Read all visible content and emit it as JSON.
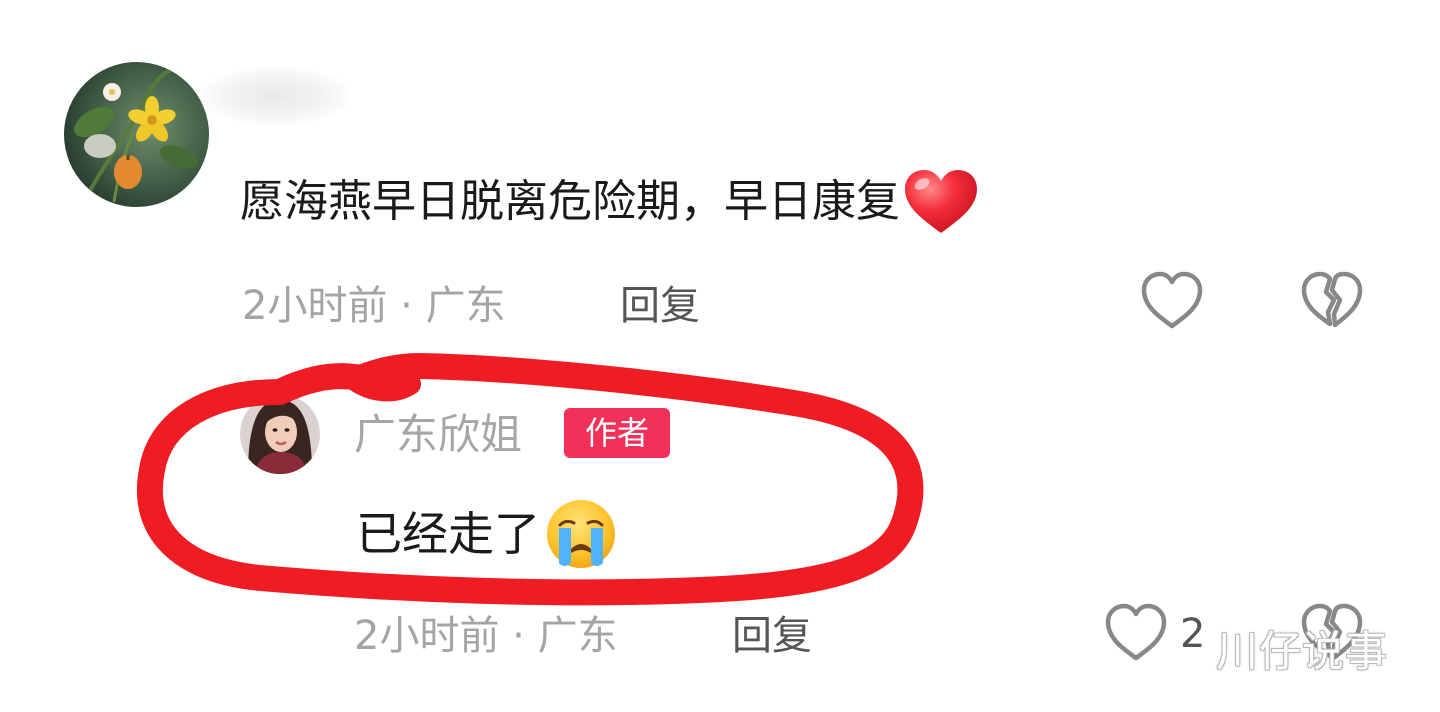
{
  "comment": {
    "text": "愿海燕早日脱离危险期，早日康复",
    "emoji": "red-heart-emoji",
    "meta": "2小时前 · 广东",
    "reply_label": "回复"
  },
  "reply": {
    "username": "广东欣姐",
    "badge": "作者",
    "text": "已经走了",
    "emoji": "loudly-crying-face-emoji",
    "meta": "2小时前 · 广东",
    "reply_label": "回复",
    "like_count": "2"
  },
  "watermark": "川仔说事",
  "colors": {
    "badge": "#f2315b",
    "annotation": "#ef1c23",
    "meta_text": "#a4a4a4"
  }
}
